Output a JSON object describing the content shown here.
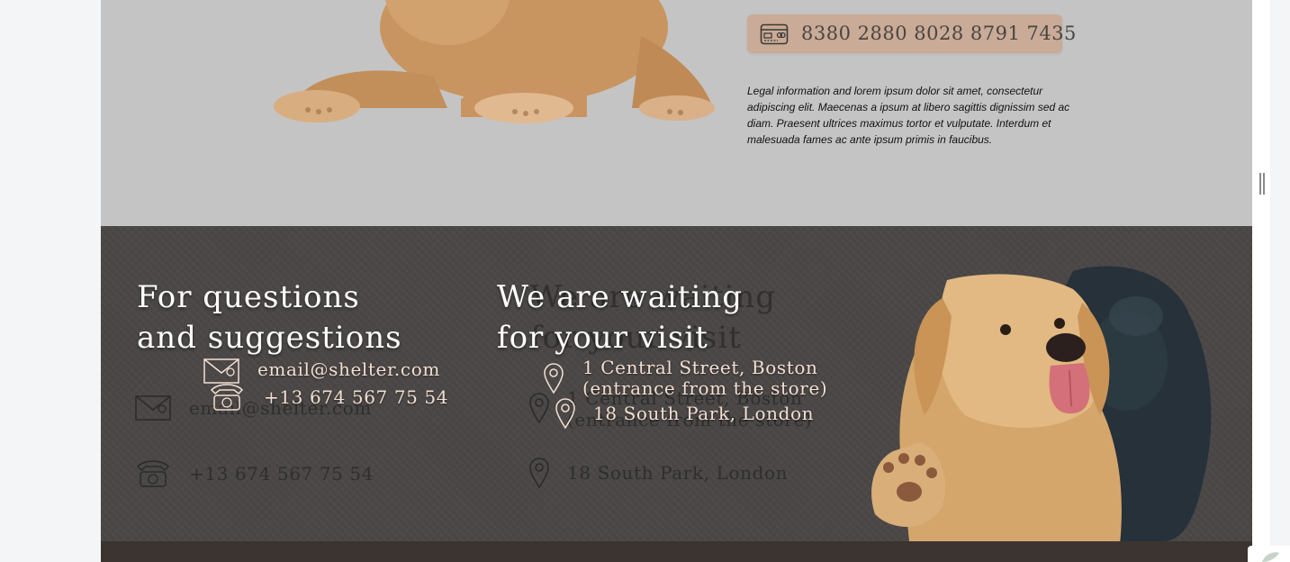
{
  "donation": {
    "card_number": "8380 2880 8028 8791 7435",
    "legal_text": "Legal information and lorem ipsum dolor sit amet, consectetur adipiscing elit. Maecenas a ipsum at libero sagittis dignissim sed ac diam. Praesent ultrices maximus tortor et vulputate. Interdum et malesuada fames ac ante ipsum primis in faucibus."
  },
  "footer": {
    "contact": {
      "title_line1": "For questions",
      "title_line2": "and suggestions",
      "email": "email@shelter.com",
      "phone": "+13 674 567 75 54"
    },
    "visit": {
      "title_line1": "We are waiting",
      "title_line2": "for your visit",
      "address1_line1": "1 Central Street, Boston",
      "address1_line2": "(entrance from the store)",
      "address2": "18 South Park, London"
    }
  },
  "colors": {
    "page_bg": "#c4c4c4",
    "footer_bg": "#4a4746",
    "card_bg": "#c9ab97",
    "footer_text": "#f4dfd2"
  },
  "icons": [
    "credit-card-icon",
    "envelope-icon",
    "telephone-icon",
    "location-pin-icon"
  ]
}
